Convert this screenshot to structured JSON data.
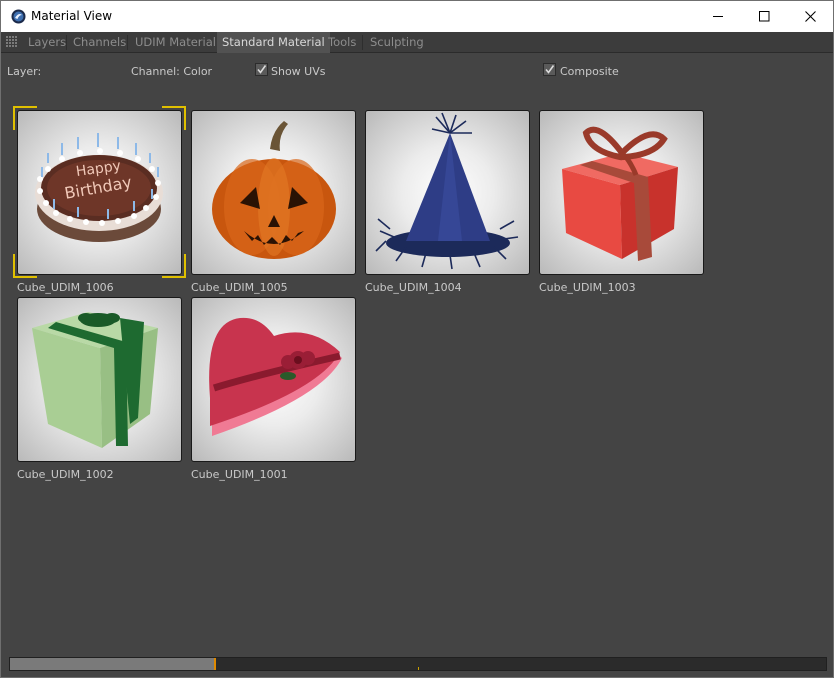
{
  "window": {
    "title": "Material View",
    "icons": {
      "app": "maya-icon",
      "minimize": "minimize-icon",
      "maximize": "maximize-icon",
      "close": "close-icon"
    }
  },
  "menu": {
    "items": [
      {
        "label": "Layers"
      },
      {
        "label": "Channels"
      },
      {
        "label": "UDIM Material"
      },
      {
        "label": "Standard Material",
        "active": true
      },
      {
        "label": "Tools"
      },
      {
        "label": "Sculpting"
      }
    ]
  },
  "options": {
    "layer_label": "Layer:",
    "channel_label": "Channel: Color",
    "show_uvs": {
      "label": "Show UVs",
      "checked": true
    },
    "composite": {
      "label": "Composite",
      "checked": true
    }
  },
  "tiles": [
    {
      "label": "Cube_UDIM_1006",
      "content": "birthday-cake",
      "selected": true
    },
    {
      "label": "Cube_UDIM_1005",
      "content": "pumpkin"
    },
    {
      "label": "Cube_UDIM_1004",
      "content": "party-hat"
    },
    {
      "label": "Cube_UDIM_1003",
      "content": "red-gift-box"
    },
    {
      "label": "Cube_UDIM_1002",
      "content": "green-gift-box"
    },
    {
      "label": "Cube_UDIM_1001",
      "content": "heart-box"
    }
  ],
  "cake_text": [
    "Happy",
    "Birthday"
  ],
  "progress": {
    "fraction": 0.25
  },
  "colors": {
    "selection": "#e0c000",
    "progress_marker": "#e08a00",
    "background": "#444444"
  }
}
